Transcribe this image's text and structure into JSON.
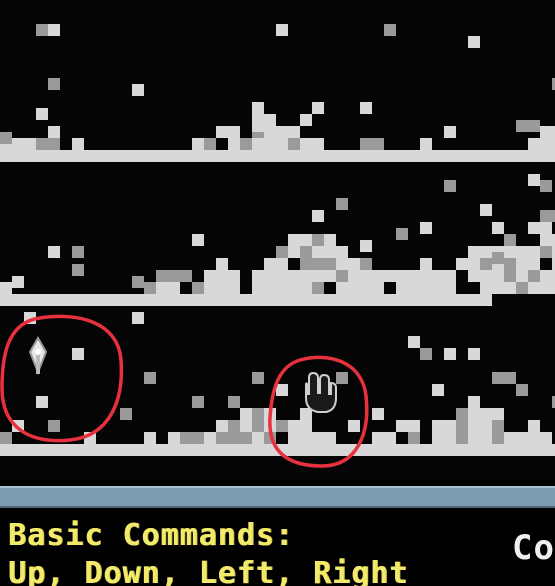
{
  "game_view": {
    "background": "#050505",
    "tile_light": "#d8d8d8",
    "tile_mid": "#9a9a9a",
    "tile_dark": "#2a2a2a",
    "annotation_color": "#e8313e",
    "player_icon": "flame-sprite-icon",
    "cursor_icon": "hand-cursor-icon"
  },
  "divider": {
    "color": "#7e9cb1"
  },
  "info_panel": {
    "commands_title": "Basic Commands:",
    "commands_list": "Up, Down, Left, Right",
    "cut_off_text": "Co",
    "text_color": "#f2ea6a"
  }
}
